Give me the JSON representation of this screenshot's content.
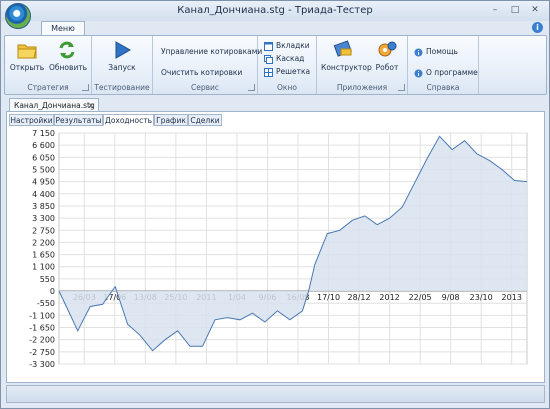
{
  "window": {
    "title": "Канал_Дончиана.stg - Триада-Тестер",
    "minimize_glyph": "–",
    "maximize_glyph": "□",
    "close_glyph": "✕"
  },
  "menu_tab": "Меню",
  "help_glyph": "i",
  "ribbon": {
    "groups": {
      "strategy": {
        "label": "Стратегия",
        "open": "Открыть",
        "refresh": "Обновить"
      },
      "testing": {
        "label": "Тестирование",
        "run": "Запуск"
      },
      "service": {
        "label": "Сервис",
        "manage_quotes": "Управление котировками",
        "clear_quotes": "Очистить котировки"
      },
      "window": {
        "label": "Окно",
        "tabs": "Вкладки",
        "cascade": "Каскад",
        "grid": "Решетка"
      },
      "apps": {
        "label": "Приложения",
        "constructor": "Конструктор",
        "robot": "Робот"
      },
      "help": {
        "label": "Справка",
        "help": "Помощь",
        "about": "О программе"
      }
    },
    "icons": [
      "folder-icon",
      "refresh-icon",
      "play-icon",
      "tabs-icon",
      "cascade-icon",
      "grid-icon",
      "constructor-icon",
      "robot-icon",
      "info-icon"
    ]
  },
  "doc_tab": {
    "title": "Канал_Дончиана.stg",
    "close": "✕"
  },
  "subtabs": [
    "Настройки",
    "Результаты",
    "Доходность",
    "График",
    "Сделки"
  ],
  "active_subtab": "Доходность",
  "colors": {
    "line": "#4a78b0",
    "fill": "#d7e2ee",
    "grid": "#e0e0e0"
  },
  "chart_data": {
    "type": "area",
    "title": "",
    "xlabel": "",
    "ylabel": "",
    "ylim": [
      -3300,
      7150
    ],
    "y_ticks": [
      "7 150",
      "6 600",
      "6 050",
      "5 500",
      "4 950",
      "4 400",
      "3 850",
      "3 300",
      "2 750",
      "2 200",
      "1 650",
      "1 100",
      "550",
      "0",
      "-550",
      "-1 100",
      "-1 650",
      "-2 200",
      "-2 750",
      "-3 300"
    ],
    "x_ticks": [
      "26/03",
      "17/06",
      "13/08",
      "25/10",
      "2011",
      "1/04",
      "9/06",
      "16/08",
      "17/10",
      "28/12",
      "2012",
      "22/05",
      "9/08",
      "23/10",
      "2013"
    ],
    "grid": true,
    "series": [
      {
        "x_index": [
          0,
          0.3,
          0.6,
          1.0,
          1.4,
          1.8,
          2.2,
          2.6,
          3.0,
          3.4,
          3.8,
          4.2,
          4.6,
          5.0,
          5.4,
          5.8,
          6.2,
          6.6,
          7.0,
          7.4,
          7.8,
          8.0,
          8.2,
          8.6,
          9.0,
          9.4,
          9.8,
          10.2,
          10.6,
          11.0,
          11.4,
          11.8,
          12.2,
          12.6,
          13.0,
          13.4,
          13.8,
          14.2,
          14.6,
          15.0
        ],
        "values": [
          0,
          -900,
          -1800,
          -700,
          -600,
          200,
          -1500,
          -2000,
          -2700,
          -2200,
          -1800,
          -2500,
          -2500,
          -1300,
          -1200,
          -1300,
          -1000,
          -1400,
          -900,
          -1300,
          -900,
          0,
          1200,
          2600,
          2750,
          3200,
          3400,
          3000,
          3300,
          3800,
          4900,
          6000,
          7000,
          6400,
          6800,
          6200,
          5900,
          5500,
          5000,
          4950
        ]
      }
    ]
  }
}
